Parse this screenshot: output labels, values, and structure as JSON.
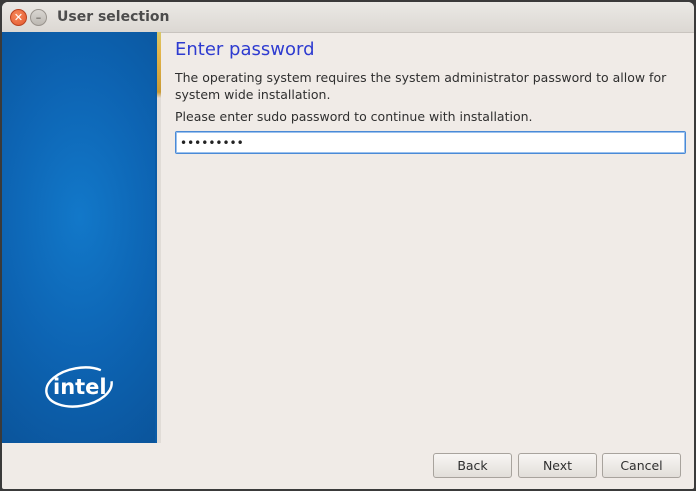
{
  "window": {
    "title": "User selection"
  },
  "sidebar": {
    "logo_text": "intel",
    "colors": {
      "primary": "#0d64b3",
      "dark": "#0a4f93"
    }
  },
  "content": {
    "heading": "Enter password",
    "description": "The operating system requires the system administrator password to allow for system wide installation.",
    "prompt": "Please enter sudo password to continue with installation.",
    "password_value": "•••••••••"
  },
  "buttons": {
    "back_label": "Back",
    "next_label": "Next",
    "cancel_label": "Cancel"
  },
  "colors": {
    "heading": "#2e3bd0",
    "close_button": "#e4572e",
    "focus_border": "#4a8ad6"
  }
}
